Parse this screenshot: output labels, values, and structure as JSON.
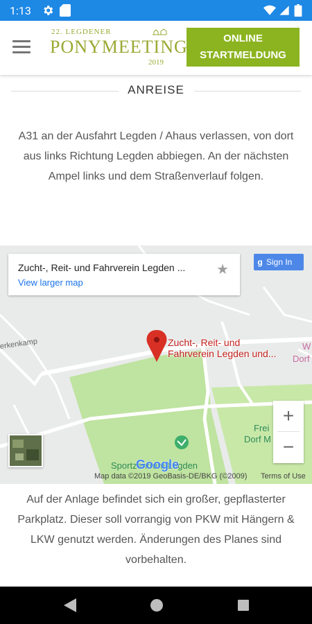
{
  "statusbar": {
    "time": "1:13"
  },
  "header": {
    "logo": {
      "line1": "22. LEGDENER",
      "line2": "PONYMEETING",
      "year": "2019"
    },
    "cta_label_line1": "ONLINE",
    "cta_label_line2": "STARTMELDUNG"
  },
  "section": {
    "title": "ANREISE"
  },
  "directions": "A31 an der Ausfahrt Legden / Ahaus verlassen, von dort aus links Richtung Legden abbiegen. An der nächsten Ampel links und dem Straßenverlauf folgen.",
  "map": {
    "place_name": "Zucht-, Reit- und Fahrverein Legden ...",
    "view_larger": "View larger map",
    "signin": "Sign In",
    "pin_label_line1": "Zucht-, Reit- und",
    "pin_label_line2": "Fahrverein Legden und...",
    "road_label": "erkenkamp",
    "right_label_line1": "W",
    "right_label_line2": "Dorf",
    "frei_line1": "Frei",
    "frei_line2": "Dorf M",
    "sportzentrum": "Sportzentrum Legden",
    "google": "Google",
    "map_data": "Map data ©2019 GeoBasis-DE/BKG (©2009)",
    "terms": "Terms of Use",
    "zoom_in": "+",
    "zoom_out": "−"
  },
  "parking": "Auf der Anlage befindet sich ein großer, gepflasterter Parkplatz. Dieser soll vorrangig von PKW mit Hängern & LKW genutzt werden. Änderungen des Planes sind vorbehalten.",
  "colors": {
    "statusbar": "#1e88e5",
    "brand_green": "#8cb420",
    "logo_green": "#9aa832",
    "park_green": "#bfe3a0",
    "pin_red": "#d93025"
  },
  "icons": [
    "gear-icon",
    "sd-card-icon",
    "wifi-icon",
    "signal-icon",
    "battery-icon",
    "menu-icon",
    "star-icon",
    "map-pin-icon",
    "back-icon",
    "home-icon",
    "recents-icon"
  ]
}
